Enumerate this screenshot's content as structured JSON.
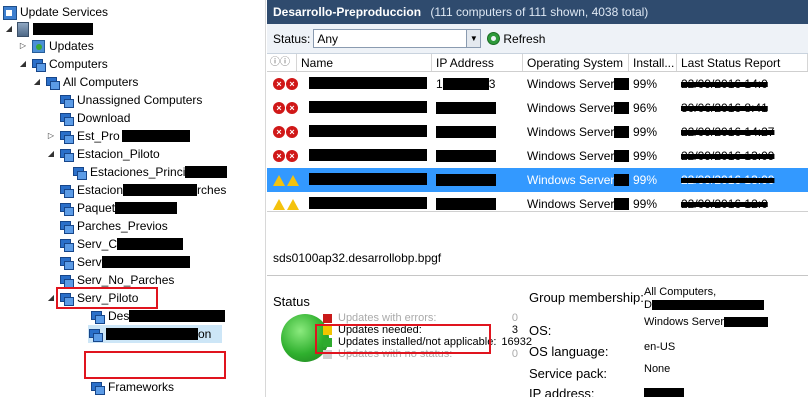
{
  "tree": {
    "root": "Update Services",
    "server": "",
    "updates": "Updates",
    "computers": "Computers",
    "all_computers": "All Computers",
    "items": {
      "unassigned": "Unassigned Computers",
      "download": "Download",
      "est_pro": "Est_Pro",
      "estacion_piloto": "Estacion_Piloto",
      "estaciones_princi": "Estaciones_Princi",
      "estacion_parches_a": "Estacion",
      "estacion_parches_b": "rches",
      "paquet": "Paquet",
      "parches_previos": "Parches_Previos",
      "serv_c": "Serv_C",
      "serv": "Serv",
      "serv_no_parches": "Serv_No_Parches",
      "serv_piloto": "Serv_Piloto",
      "des": "Des",
      "on": "on",
      "frameworks": "Frameworks"
    }
  },
  "header": {
    "title": "Desarrollo-Preproduccion",
    "subtitle": "(111 computers of 111 shown, 4038 total)"
  },
  "filter": {
    "status_label": "Status:",
    "status_value": "Any",
    "refresh_label": "Refresh"
  },
  "grid": {
    "columns": [
      "Name",
      "IP Address",
      "Operating System",
      "Install...",
      "Last Status Report"
    ],
    "rows": [
      {
        "status": "error",
        "ip": "1",
        "ip_tail": "3",
        "os": "Windows Server",
        "installed": "99%",
        "report": "22/09/2016 14:0"
      },
      {
        "status": "error",
        "ip": "",
        "ip_tail": "",
        "os": "Windows Server",
        "installed": "96%",
        "report": "30/06/2016 8:41"
      },
      {
        "status": "error",
        "ip": "",
        "ip_tail": "",
        "os": "Windows Server",
        "installed": "99%",
        "report": "22/09/2016 14:27"
      },
      {
        "status": "error",
        "ip": "",
        "ip_tail": "",
        "os": "Windows Server",
        "installed": "99%",
        "report": "22/09/2016 13:09"
      },
      {
        "status": "warning",
        "ip": "",
        "ip_tail": "",
        "os": "Windows Server",
        "installed": "99%",
        "report": "22/09/2016 13:00"
      },
      {
        "status": "warning",
        "ip": "",
        "ip_tail": "",
        "os": "Windows Server",
        "installed": "99%",
        "report": "22/09/2016 12:0"
      }
    ]
  },
  "detail": {
    "computer_name": "sds0100ap32.desarrollobp.bpgf",
    "status_title": "Status",
    "legend": [
      {
        "label": "Updates with errors:",
        "value": "0",
        "color": "#c91a1a"
      },
      {
        "label": "Updates needed:",
        "value": "3",
        "color": "#f2c400"
      },
      {
        "label": "Updates installed/not applicable:",
        "value": "16932",
        "color": "#2eaa2e"
      },
      {
        "label": "Updates with no status:",
        "value": "0",
        "color": "#d0d0d0"
      }
    ],
    "group_label": "Group membership:",
    "group_value": "All Computers,",
    "group_value_line2": "D",
    "os_label": "OS:",
    "os_value": "Windows Server",
    "lang_label": "OS language:",
    "lang_value": "en-US",
    "sp_label": "Service pack:",
    "sp_value": "None",
    "ip_label": "IP address:"
  }
}
